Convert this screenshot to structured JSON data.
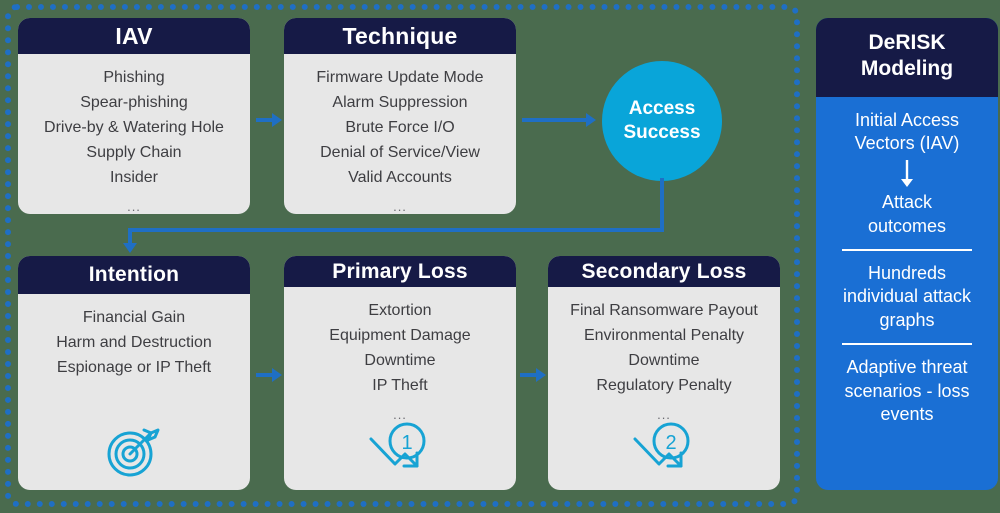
{
  "theme": {
    "background": "#4a6b4e",
    "frame_border": "#1f6fc4",
    "card_header_bg": "#161a46",
    "card_body_bg": "#e7e7e7",
    "accent_cyan": "#09a5d9",
    "accent_blue": "#1a6fd4",
    "text_dark": "#3e3e42",
    "text_light": "#ffffff"
  },
  "cards": {
    "iav": {
      "title": "IAV",
      "items": [
        "Phishing",
        "Spear-phishing",
        "Drive-by & Watering Hole",
        "Supply Chain",
        "Insider"
      ],
      "ellipsis": "..."
    },
    "technique": {
      "title": "Technique",
      "items": [
        "Firmware Update Mode",
        "Alarm Suppression",
        "Brute Force I/O",
        "Denial of Service/View",
        "Valid Accounts"
      ],
      "ellipsis": "..."
    },
    "intention": {
      "title": "Intention",
      "items": [
        "Financial Gain",
        "Harm and Destruction",
        "Espionage or IP Theft"
      ],
      "icon": "target-arrow-icon"
    },
    "primary_loss": {
      "title": "Primary Loss",
      "items": [
        "Extortion",
        "Equipment Damage",
        "Downtime",
        "IP Theft"
      ],
      "ellipsis": "...",
      "icon": "declining-trend-1-icon",
      "badge": "1"
    },
    "secondary_loss": {
      "title": "Secondary Loss",
      "items": [
        "Final Ransomware Payout",
        "Environmental Penalty",
        "Downtime",
        "Regulatory Penalty"
      ],
      "ellipsis": "...",
      "icon": "declining-trend-2-icon",
      "badge": "2"
    }
  },
  "access_success": {
    "label": "Access Success",
    "line1": "Access",
    "line2": "Success"
  },
  "derisk_panel": {
    "title_line1": "DeRISK",
    "title_line2": "Modeling",
    "blocks": [
      {
        "text_line1": "Initial Access",
        "text_line2": "Vectors (IAV)"
      },
      {
        "text_line1": "Attack",
        "text_line2": "outcomes"
      },
      {
        "text_line1": "Hundreds",
        "text_line2": "individual attack",
        "text_line3": "graphs"
      },
      {
        "text_line1": "Adaptive threat",
        "text_line2": "scenarios - loss",
        "text_line3": "events"
      }
    ]
  },
  "connectors": [
    {
      "name": "iav-to-technique",
      "direction": "right"
    },
    {
      "name": "technique-to-access-success",
      "direction": "right"
    },
    {
      "name": "access-success-to-intention",
      "direction": "down-left"
    },
    {
      "name": "intention-to-primary-loss",
      "direction": "right"
    },
    {
      "name": "primary-loss-to-secondary-loss",
      "direction": "right"
    }
  ]
}
